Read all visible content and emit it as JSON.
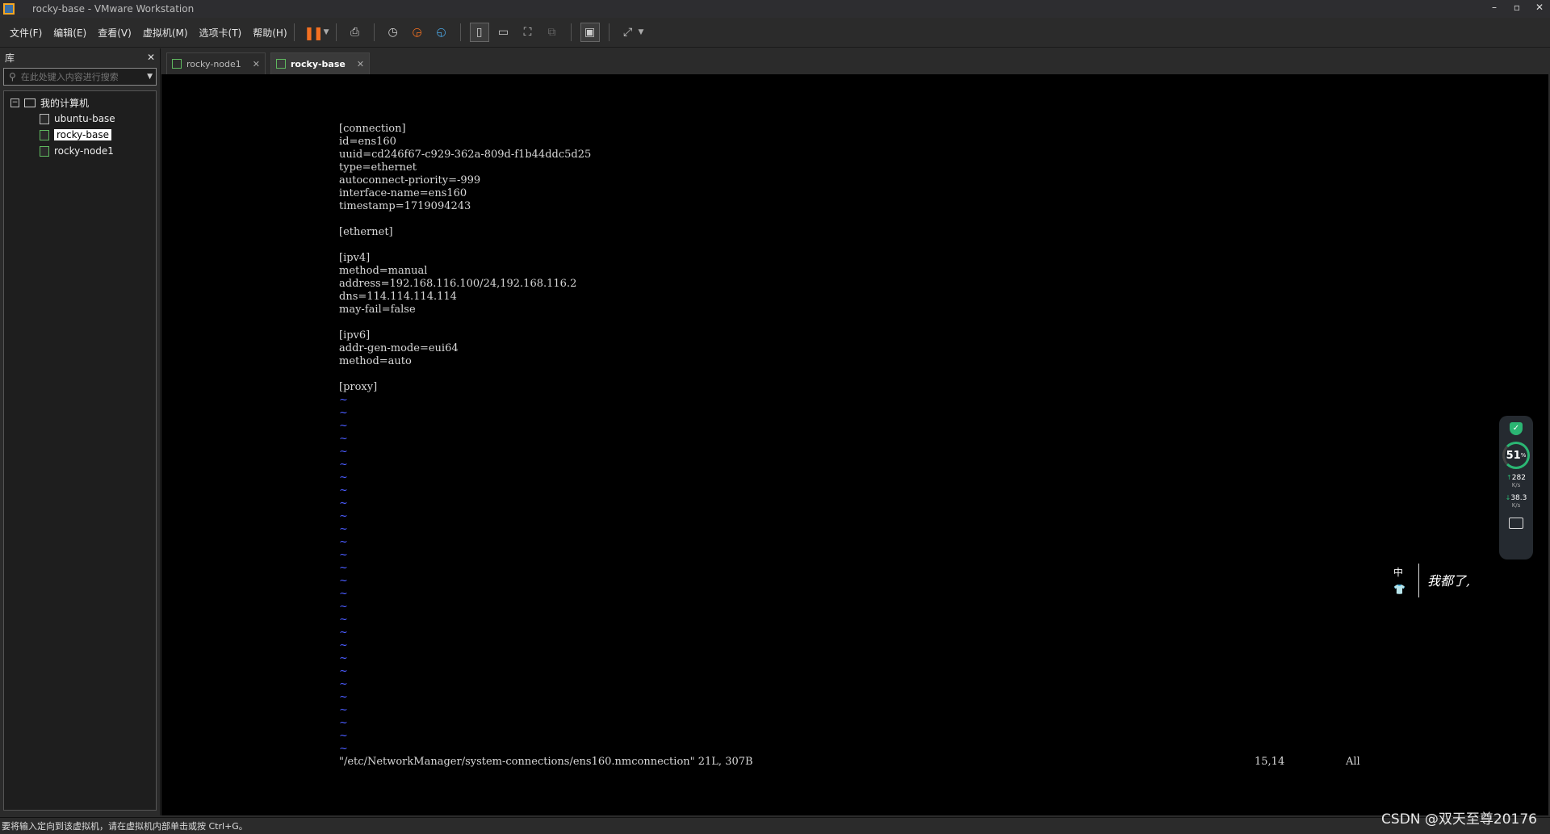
{
  "window": {
    "title": "rocky-base - VMware Workstation",
    "controls": [
      "–",
      "▫",
      "✕"
    ]
  },
  "menu": [
    "文件(F)",
    "编辑(E)",
    "查看(V)",
    "虚拟机(M)",
    "选项卡(T)",
    "帮助(H)"
  ],
  "toolbar": {
    "icons": [
      "pause-icon",
      "send-ctrl-alt-del-icon",
      "snapshot-icon",
      "revert-snapshot-icon",
      "snapshot-manager-icon",
      "show-library-icon",
      "thumbnail-bar-icon",
      "full-screen-icon",
      "unity-icon",
      "console-view-icon",
      "stretch-icon"
    ]
  },
  "library": {
    "title": "库",
    "close": "✕",
    "search_placeholder": "在此处键入内容进行搜索",
    "root": "我的计算机",
    "items": [
      {
        "label": "ubuntu-base",
        "running": false,
        "selected": false
      },
      {
        "label": "rocky-base",
        "running": true,
        "selected": true
      },
      {
        "label": "rocky-node1",
        "running": true,
        "selected": false
      }
    ]
  },
  "tabs": [
    {
      "label": "rocky-node1",
      "active": false,
      "close": "✕"
    },
    {
      "label": "rocky-base",
      "active": true,
      "close": "✕"
    }
  ],
  "terminal": {
    "lines": [
      "[connection]",
      "id=ens160",
      "uuid=cd246f67-c929-362a-809d-f1b44ddc5d25",
      "type=ethernet",
      "autoconnect-priority=-999",
      "interface-name=ens160",
      "timestamp=1719094243",
      "",
      "[ethernet]",
      "",
      "[ipv4]",
      "method=manual",
      "address=192.168.116.100/24,192.168.116.2",
      "dns=114.114.114.114",
      "may-fail=false",
      "",
      "[ipv6]",
      "addr-gen-mode=eui64",
      "method=auto",
      "",
      "[proxy]"
    ],
    "tilde": "~",
    "tilde_count": 28,
    "status_file": "\"/etc/NetworkManager/system-connections/ens160.nmconnection\" 21L, 307B",
    "status_pos": "15,14",
    "status_all": "All"
  },
  "widget": {
    "percent": "51",
    "percent_unit": "%",
    "upload": "282",
    "upload_unit": "K/s",
    "download": "38.3",
    "download_unit": "K/s",
    "accent": "#2bb673"
  },
  "ime": {
    "mode": "中",
    "text": "我都了,"
  },
  "statusbar": {
    "hint": "要将输入定向到该虚拟机，请在虚拟机内部单击或按 Ctrl+G。",
    "watermark": "CSDN @双天至尊20176"
  }
}
